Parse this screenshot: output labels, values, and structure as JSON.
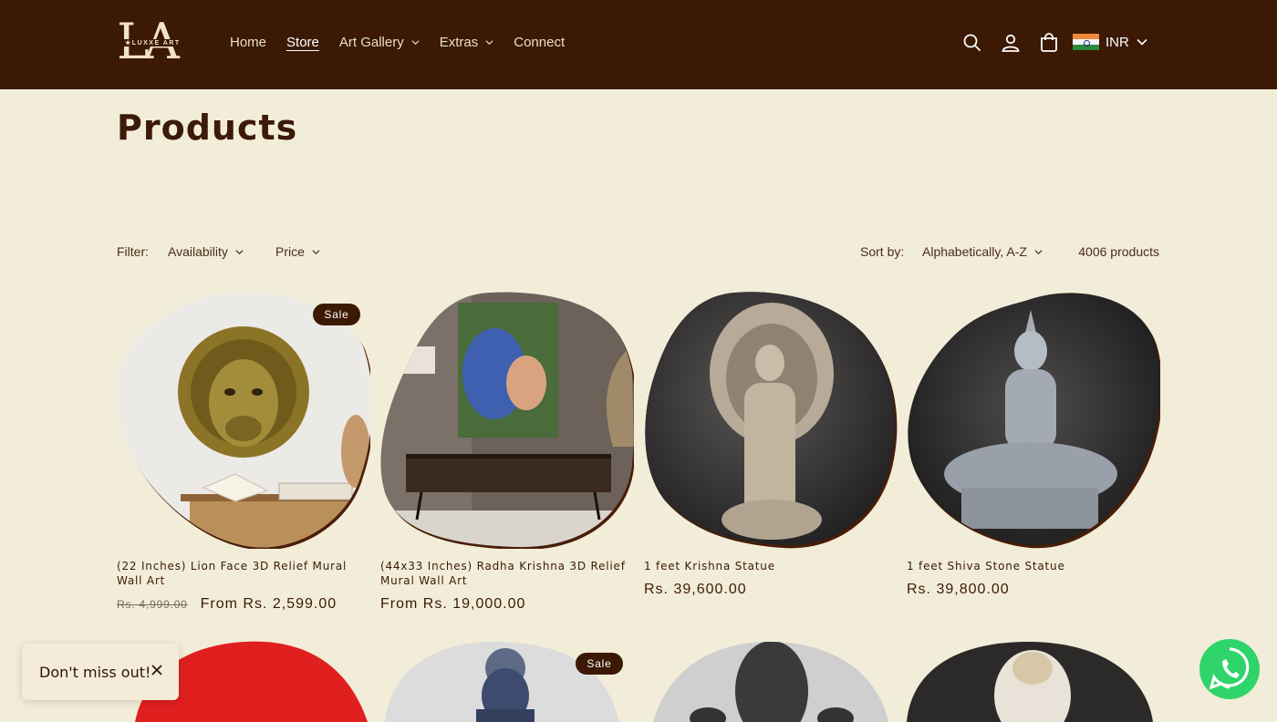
{
  "brand": {
    "logo_big": "LA",
    "logo_small": "★LUXXE ART"
  },
  "nav": {
    "items": [
      {
        "label": "Home",
        "dropdown": false,
        "active": false
      },
      {
        "label": "Store",
        "dropdown": false,
        "active": true
      },
      {
        "label": "Art Gallery",
        "dropdown": true,
        "active": false
      },
      {
        "label": "Extras",
        "dropdown": true,
        "active": false
      },
      {
        "label": "Connect",
        "dropdown": false,
        "active": false
      }
    ]
  },
  "header_icons": [
    "search-icon",
    "account-icon",
    "cart-icon"
  ],
  "currency": {
    "code": "INR",
    "flag": "india-flag-icon"
  },
  "page": {
    "title": "Products"
  },
  "filters": {
    "label": "Filter:",
    "availability": "Availability",
    "price": "Price",
    "sort_label": "Sort by:",
    "sort_value": "Alphabetically, A-Z",
    "count": "4006 products"
  },
  "products": [
    {
      "title": "(22 Inches) Lion Face 3D Relief Mural Wall Art",
      "old_price": "Rs. 4,999.00",
      "price": "From Rs. 2,599.00",
      "badge": "Sale"
    },
    {
      "title": "(44x33 Inches) Radha Krishna 3D Relief Mural Wall Art",
      "old_price": "",
      "price": "From Rs. 19,000.00",
      "badge": ""
    },
    {
      "title": "1 feet Krishna Statue",
      "old_price": "",
      "price": "Rs. 39,600.00",
      "badge": ""
    },
    {
      "title": "1 feet Shiva Stone Statue",
      "old_price": "",
      "price": "Rs. 39,800.00",
      "badge": ""
    }
  ],
  "products_row2": [
    {
      "badge": ""
    },
    {
      "badge": "Sale"
    },
    {
      "badge": ""
    },
    {
      "badge": ""
    }
  ],
  "popup": {
    "text": "Don't miss out!"
  },
  "colors": {
    "header_bg": "#3b1905",
    "page_bg": "#f2edd9",
    "text": "#3b1a07",
    "whatsapp": "#2fd46a",
    "accent_red": "#e01f1f"
  }
}
